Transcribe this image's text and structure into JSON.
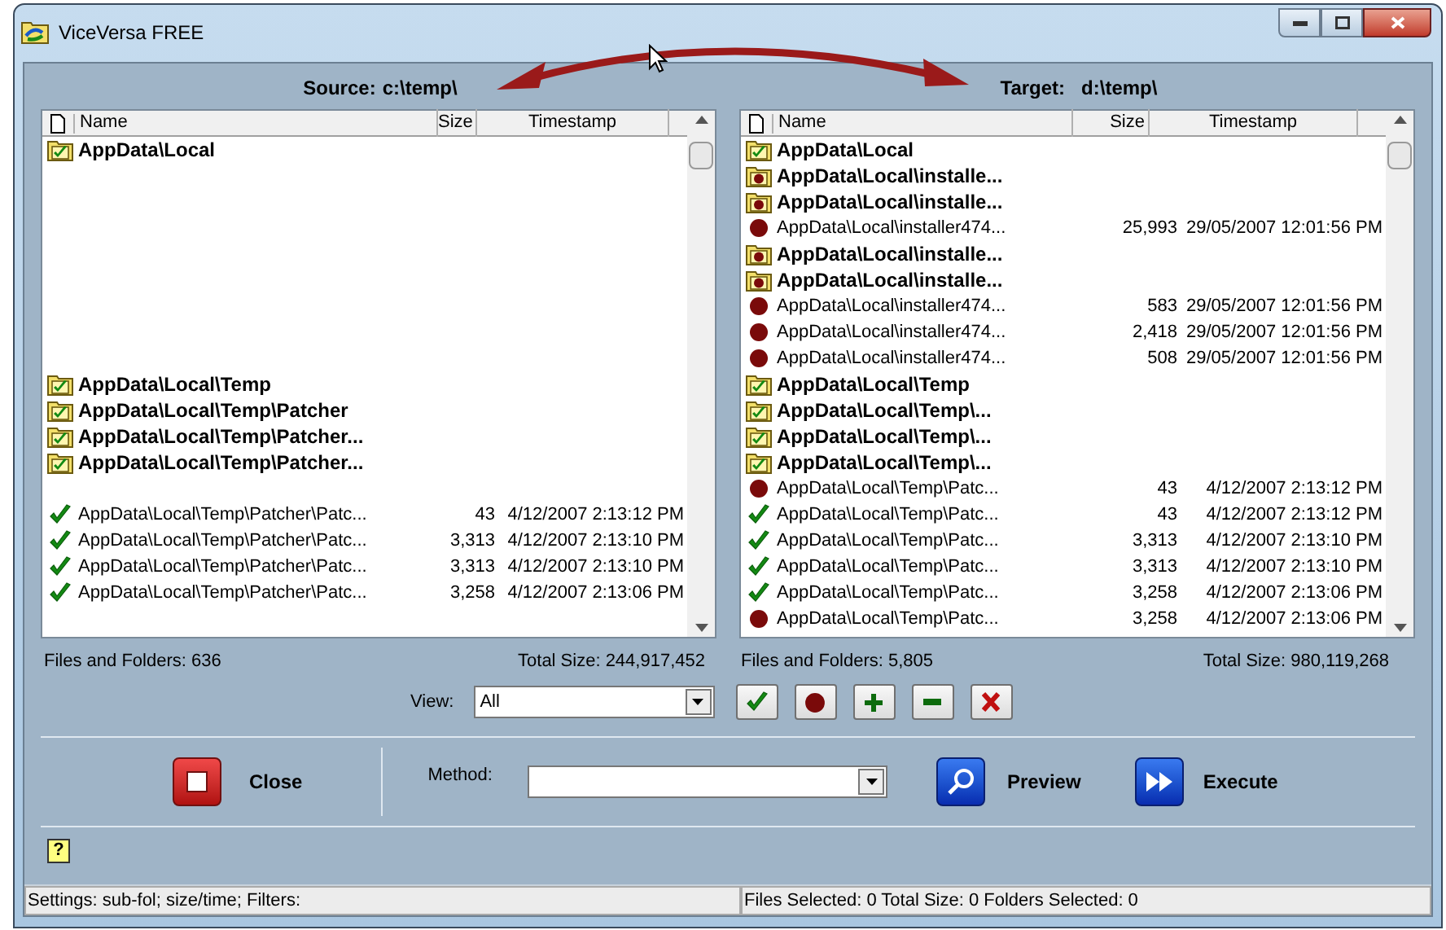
{
  "window": {
    "title": "ViceVersa FREE"
  },
  "source": {
    "label": "Source:",
    "path": "c:\\temp\\",
    "columns": [
      "Name",
      "Size",
      "Timestamp"
    ],
    "rows": [
      {
        "kind": "folder-check",
        "name": "AppData\\Local"
      },
      {
        "kind": "blank"
      },
      {
        "kind": "blank"
      },
      {
        "kind": "blank"
      },
      {
        "kind": "blank"
      },
      {
        "kind": "blank"
      },
      {
        "kind": "blank"
      },
      {
        "kind": "blank"
      },
      {
        "kind": "blank"
      },
      {
        "kind": "folder-check",
        "name": "AppData\\Local\\Temp"
      },
      {
        "kind": "folder-check",
        "name": "AppData\\Local\\Temp\\Patcher"
      },
      {
        "kind": "folder-check",
        "name": "AppData\\Local\\Temp\\Patcher..."
      },
      {
        "kind": "folder-check",
        "name": "AppData\\Local\\Temp\\Patcher..."
      },
      {
        "kind": "blank"
      },
      {
        "kind": "file-check",
        "name": "AppData\\Local\\Temp\\Patcher\\Patc...",
        "size": "43",
        "timestamp": "4/12/2007 2:13:12 PM"
      },
      {
        "kind": "file-check",
        "name": "AppData\\Local\\Temp\\Patcher\\Patc...",
        "size": "3,313",
        "timestamp": "4/12/2007 2:13:10 PM"
      },
      {
        "kind": "file-check",
        "name": "AppData\\Local\\Temp\\Patcher\\Patc...",
        "size": "3,313",
        "timestamp": "4/12/2007 2:13:10 PM"
      },
      {
        "kind": "file-check",
        "name": "AppData\\Local\\Temp\\Patcher\\Patc...",
        "size": "3,258",
        "timestamp": "4/12/2007 2:13:06 PM"
      }
    ],
    "files_and_folders": "Files and Folders: 636",
    "total_size": "Total Size: 244,917,452"
  },
  "target": {
    "label": "Target:",
    "path": "d:\\temp\\",
    "columns": [
      "Name",
      "Size",
      "Timestamp"
    ],
    "rows": [
      {
        "kind": "folder-check",
        "name": "AppData\\Local"
      },
      {
        "kind": "folder-dot",
        "name": "AppData\\Local\\installe..."
      },
      {
        "kind": "folder-dot",
        "name": "AppData\\Local\\installe..."
      },
      {
        "kind": "file-dot",
        "name": "AppData\\Local\\installer474...",
        "size": "25,993",
        "timestamp": "29/05/2007 12:01:56 PM"
      },
      {
        "kind": "folder-dot",
        "name": "AppData\\Local\\installe..."
      },
      {
        "kind": "folder-dot",
        "name": "AppData\\Local\\installe..."
      },
      {
        "kind": "file-dot",
        "name": "AppData\\Local\\installer474...",
        "size": "583",
        "timestamp": "29/05/2007 12:01:56 PM"
      },
      {
        "kind": "file-dot",
        "name": "AppData\\Local\\installer474...",
        "size": "2,418",
        "timestamp": "29/05/2007 12:01:56 PM"
      },
      {
        "kind": "file-dot",
        "name": "AppData\\Local\\installer474...",
        "size": "508",
        "timestamp": "29/05/2007 12:01:56 PM"
      },
      {
        "kind": "folder-check",
        "name": "AppData\\Local\\Temp"
      },
      {
        "kind": "folder-check",
        "name": "AppData\\Local\\Temp\\..."
      },
      {
        "kind": "folder-check",
        "name": "AppData\\Local\\Temp\\..."
      },
      {
        "kind": "folder-check",
        "name": "AppData\\Local\\Temp\\..."
      },
      {
        "kind": "file-dot",
        "name": "AppData\\Local\\Temp\\Patc...",
        "size": "43",
        "timestamp": "4/12/2007 2:13:12 PM"
      },
      {
        "kind": "file-check",
        "name": "AppData\\Local\\Temp\\Patc...",
        "size": "43",
        "timestamp": "4/12/2007 2:13:12 PM"
      },
      {
        "kind": "file-check",
        "name": "AppData\\Local\\Temp\\Patc...",
        "size": "3,313",
        "timestamp": "4/12/2007 2:13:10 PM"
      },
      {
        "kind": "file-check",
        "name": "AppData\\Local\\Temp\\Patc...",
        "size": "3,313",
        "timestamp": "4/12/2007 2:13:10 PM"
      },
      {
        "kind": "file-check",
        "name": "AppData\\Local\\Temp\\Patc...",
        "size": "3,258",
        "timestamp": "4/12/2007 2:13:06 PM"
      },
      {
        "kind": "file-dot",
        "name": "AppData\\Local\\Temp\\Patc...",
        "size": "3,258",
        "timestamp": "4/12/2007 2:13:06 PM"
      }
    ],
    "files_and_folders": "Files and Folders: 5,805",
    "total_size": "Total Size: 980,119,268"
  },
  "view": {
    "label": "View:",
    "value": "All"
  },
  "filter_buttons": [
    {
      "kind": "check"
    },
    {
      "kind": "dot"
    },
    {
      "kind": "plus"
    },
    {
      "kind": "minus"
    },
    {
      "kind": "cross"
    }
  ],
  "close_button": "Close",
  "method": {
    "label": "Method:"
  },
  "preview_button": "Preview",
  "execute_button": "Execute",
  "help_button": "?",
  "status_bar": [
    "Settings: sub-fol; size/time; Filters:",
    "Files Selected: 0 Total Size: 0 Folders Selected: 0"
  ]
}
